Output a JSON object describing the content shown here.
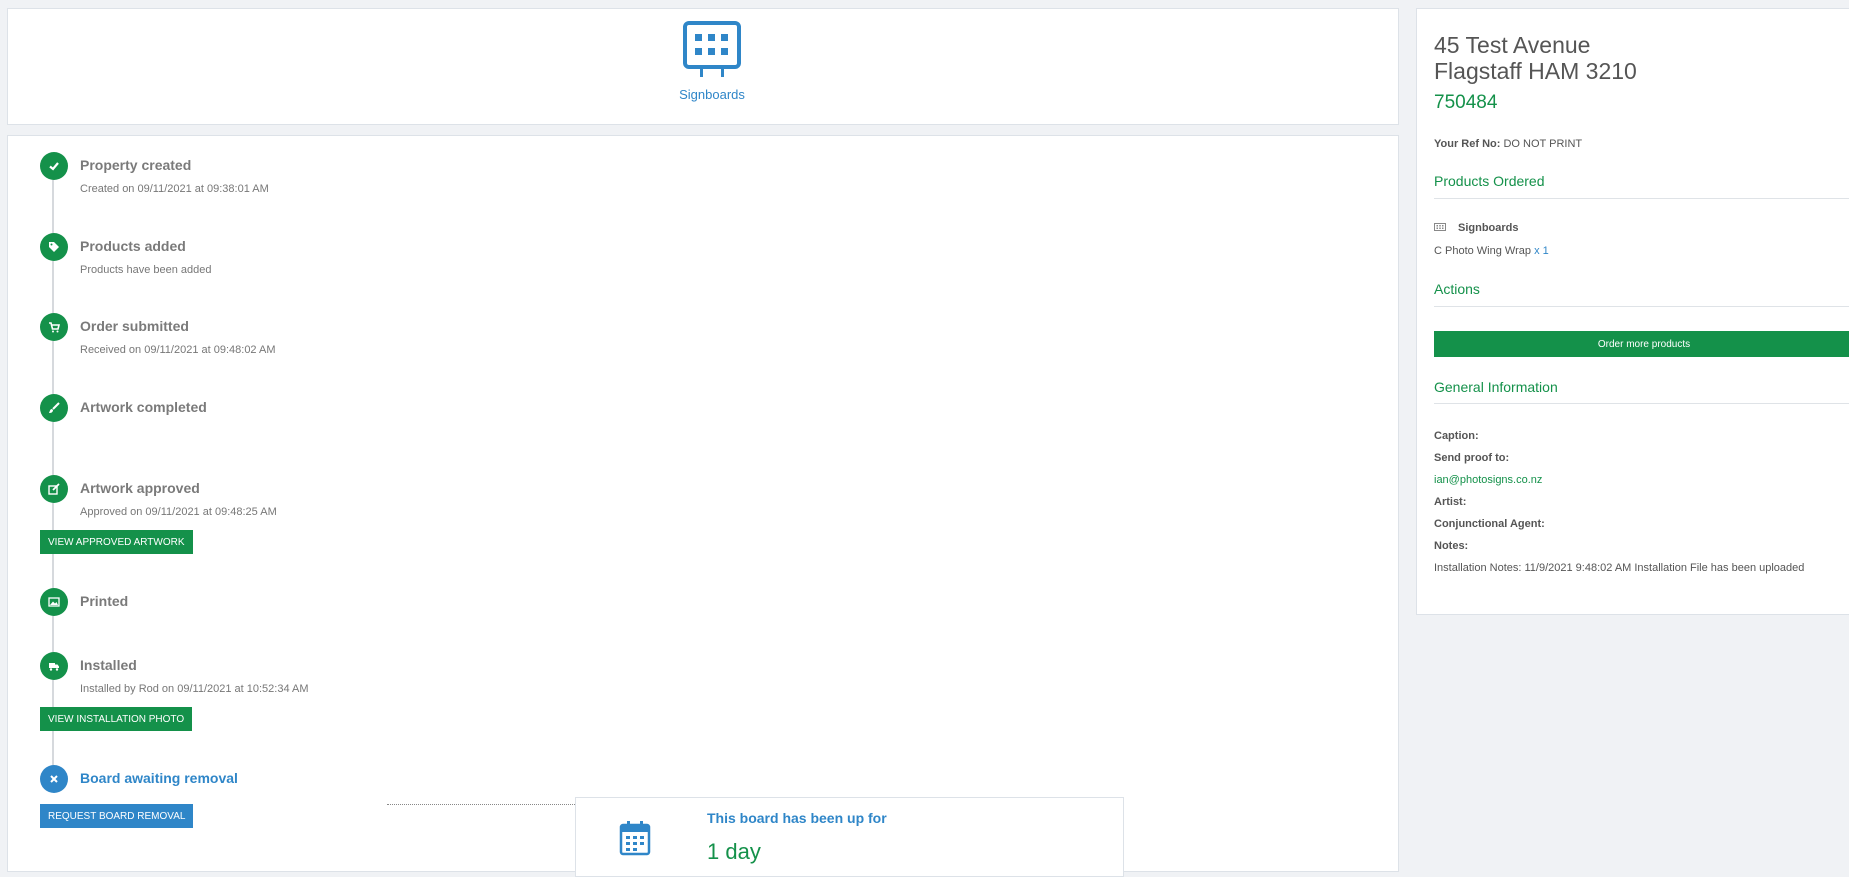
{
  "header": {
    "product_tab_label": "Signboards",
    "product_tab_icon": "signboard-icon"
  },
  "timeline": {
    "steps": [
      {
        "title": "Property created",
        "sub": "Created on 09/11/2021 at 09:38:01 AM",
        "icon": "check-icon",
        "status": "done"
      },
      {
        "title": "Products added",
        "sub": "Products have been added",
        "icon": "tag-icon",
        "status": "done"
      },
      {
        "title": "Order submitted",
        "sub": "Received on 09/11/2021 at 09:48:02 AM",
        "icon": "cart-icon",
        "status": "done"
      },
      {
        "title": "Artwork completed",
        "sub": "",
        "icon": "paintbrush-icon",
        "status": "done"
      },
      {
        "title": "Artwork approved",
        "sub": "Approved on 09/11/2021 at 09:48:25 AM",
        "icon": "edit-icon",
        "status": "done",
        "button": "VIEW APPROVED ARTWORK"
      },
      {
        "title": "Printed",
        "sub": "",
        "icon": "image-icon",
        "status": "done"
      },
      {
        "title": "Installed",
        "sub": "Installed by Rod on 09/11/2021 at 10:52:34 AM",
        "icon": "truck-icon",
        "status": "done",
        "button": "VIEW INSTALLATION PHOTO"
      },
      {
        "title": "Board awaiting removal",
        "sub": "",
        "icon": "close-icon",
        "status": "pending",
        "button": "REQUEST BOARD REMOVAL"
      }
    ],
    "board_up": {
      "label": "This board has been up for",
      "value": "1 day",
      "icon": "calendar-icon"
    }
  },
  "property": {
    "address_line1": "45 Test Avenue",
    "address_line2": "Flagstaff HAM 3210",
    "id": "750484",
    "ref_label": "Your Ref No:",
    "ref_value": "DO NOT PRINT"
  },
  "products_ordered": {
    "heading": "Products Ordered",
    "category": "Signboards",
    "item_name": "C Photo Wing Wrap",
    "item_qty": "x 1"
  },
  "actions": {
    "heading": "Actions",
    "order_more_label": "Order more products"
  },
  "general_info": {
    "heading": "General Information",
    "caption_label": "Caption:",
    "send_proof_label": "Send proof to:",
    "send_proof_value": "ian@photosigns.co.nz",
    "artist_label": "Artist:",
    "conjunctional_label": "Conjunctional Agent:",
    "notes_label": "Notes:",
    "notes_value": "Installation Notes: 11/9/2021 9:48:02 AM Installation File has been uploaded"
  },
  "colors": {
    "green": "#14914a",
    "blue": "#2f86c8"
  }
}
